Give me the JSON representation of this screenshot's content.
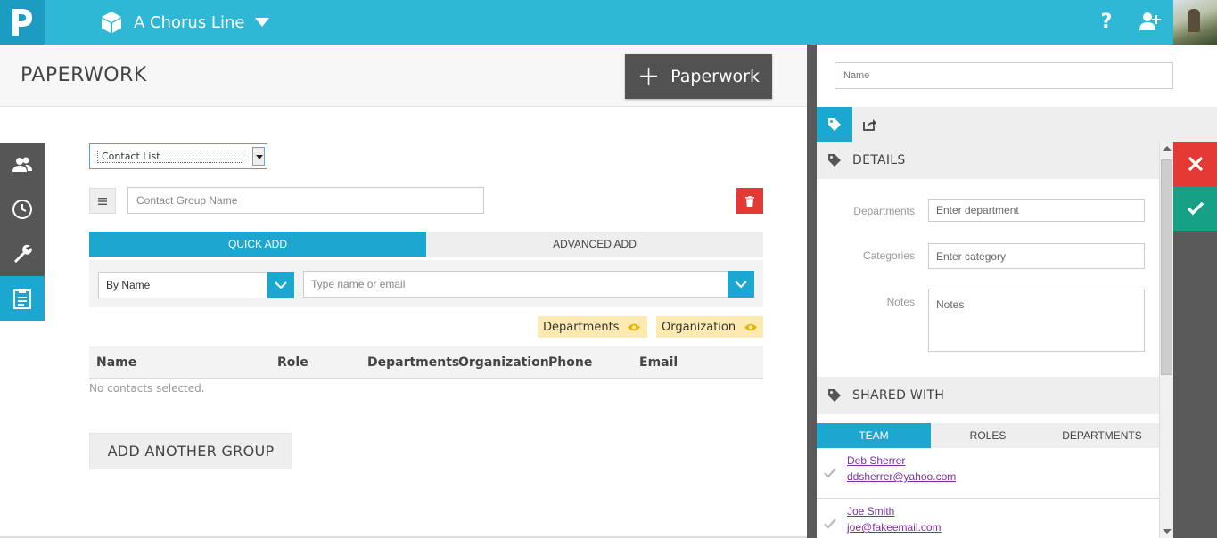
{
  "topbar": {
    "project_title": "A Chorus Line",
    "help_label": "?"
  },
  "header": {
    "page_title": "PAPERWORK",
    "add_button_label": "Paperwork",
    "add_button_plus": "+"
  },
  "form": {
    "type_select_value": "Contact List",
    "group_name_placeholder": "Contact Group Name",
    "tabs": [
      {
        "label": "QUICK ADD",
        "active": true
      },
      {
        "label": "ADVANCED ADD",
        "active": false
      }
    ],
    "search_by_value": "By Name",
    "search_placeholder": "Type name or email",
    "column_chips": [
      "Departments",
      "Organization"
    ],
    "table_columns": [
      "Name",
      "Role",
      "Departments",
      "Organization",
      "Phone",
      "Email"
    ],
    "empty_message": "No contacts selected.",
    "add_group_label": "ADD ANOTHER GROUP"
  },
  "right_panel": {
    "name_placeholder": "Name",
    "details_title": "DETAILS",
    "fields": [
      {
        "label": "Departments",
        "placeholder": "Enter department"
      },
      {
        "label": "Categories",
        "placeholder": "Enter category"
      },
      {
        "label": "Notes",
        "placeholder": "Notes"
      }
    ],
    "shared_title": "SHARED WITH",
    "share_tabs": [
      {
        "label": "TEAM",
        "active": true
      },
      {
        "label": "ROLES",
        "active": false
      },
      {
        "label": "DEPARTMENTS",
        "active": false
      }
    ],
    "members": [
      {
        "name": "Deb Sherrer",
        "email": "ddsherrer@yahoo.com"
      },
      {
        "name": "Joe Smith",
        "email": "joe@fakeemail.com"
      }
    ]
  },
  "colors": {
    "brand": "#2fb7d6",
    "accent": "#1ba7cf",
    "danger": "#e53935",
    "success": "#16a085",
    "chip": "#fdeab0",
    "dark": "#525252"
  },
  "icons": [
    "logo-icon",
    "cube-icon",
    "chevron-down-icon",
    "help-icon",
    "add-user-icon",
    "team-icon",
    "clock-icon",
    "wrench-icon",
    "clipboard-icon",
    "menu-icon",
    "trash-icon",
    "eye-icon",
    "tag-icon",
    "share-icon",
    "close-icon",
    "check-icon"
  ]
}
